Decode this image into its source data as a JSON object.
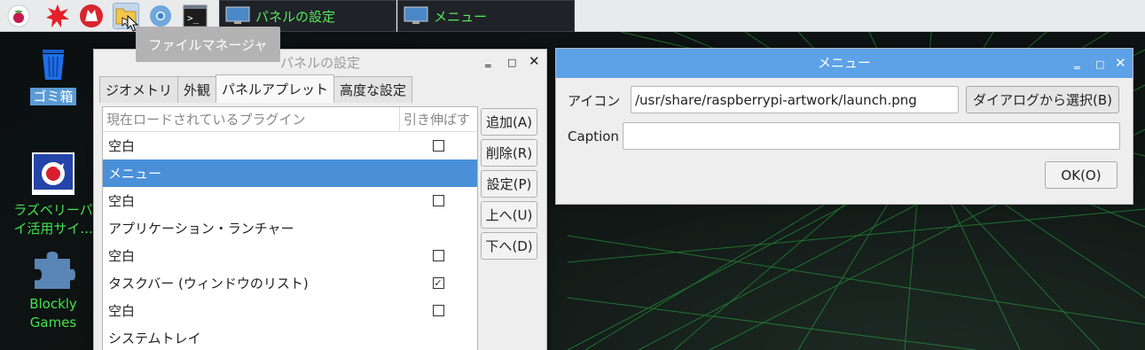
{
  "taskbar": {
    "launchers": [
      "raspberry-icon",
      "burst-icon",
      "wolfram-icon",
      "file-manager-icon",
      "browser-icon",
      "terminal-icon"
    ],
    "tasks": [
      {
        "label": "パネルの設定"
      },
      {
        "label": "メニュー"
      }
    ]
  },
  "desktop": {
    "items": [
      {
        "label": "ゴミ箱"
      },
      {
        "label": "ラズベリーパ\nイ活用サイ..."
      },
      {
        "label": "Blockly\nGames"
      }
    ]
  },
  "tooltip": {
    "text": "ファイルマネージャ"
  },
  "panel_window": {
    "title": "パネルの設定",
    "tabs": [
      "ジオメトリ",
      "外観",
      "パネルアプレット",
      "高度な設定"
    ],
    "selected_tab": "パネルアプレット",
    "list_headers": [
      "現在ロードされているプラグイン",
      "引き伸ばす"
    ],
    "rows": [
      {
        "name": "空白",
        "check": "unchecked"
      },
      {
        "name": "メニュー",
        "check": "none",
        "selected": true
      },
      {
        "name": "空白",
        "check": "unchecked"
      },
      {
        "name": "アプリケーション・ランチャー",
        "check": "none"
      },
      {
        "name": "空白",
        "check": "unchecked"
      },
      {
        "name": "タスクバー (ウィンドウのリスト)",
        "check": "checked"
      },
      {
        "name": "空白",
        "check": "unchecked"
      },
      {
        "name": "システムトレイ",
        "check": "none"
      }
    ],
    "buttons": [
      "追加(A)",
      "削除(R)",
      "設定(P)",
      "上へ(U)",
      "下へ(D)"
    ]
  },
  "menu_window": {
    "title": "メニュー",
    "icon_label": "アイコン",
    "icon_value": "/usr/share/raspberrypi-artwork/launch.png",
    "choose_button": "ダイアログから選択(B)",
    "caption_label": "Caption",
    "caption_value": "",
    "ok_button": "OK(O)"
  },
  "colors": {
    "taskbar_bg": "#e9eaec",
    "task_text": "#59e85b",
    "selection": "#4a90d9",
    "dialog_title": "#5da2e6",
    "desktop_label": "#44e24f"
  }
}
